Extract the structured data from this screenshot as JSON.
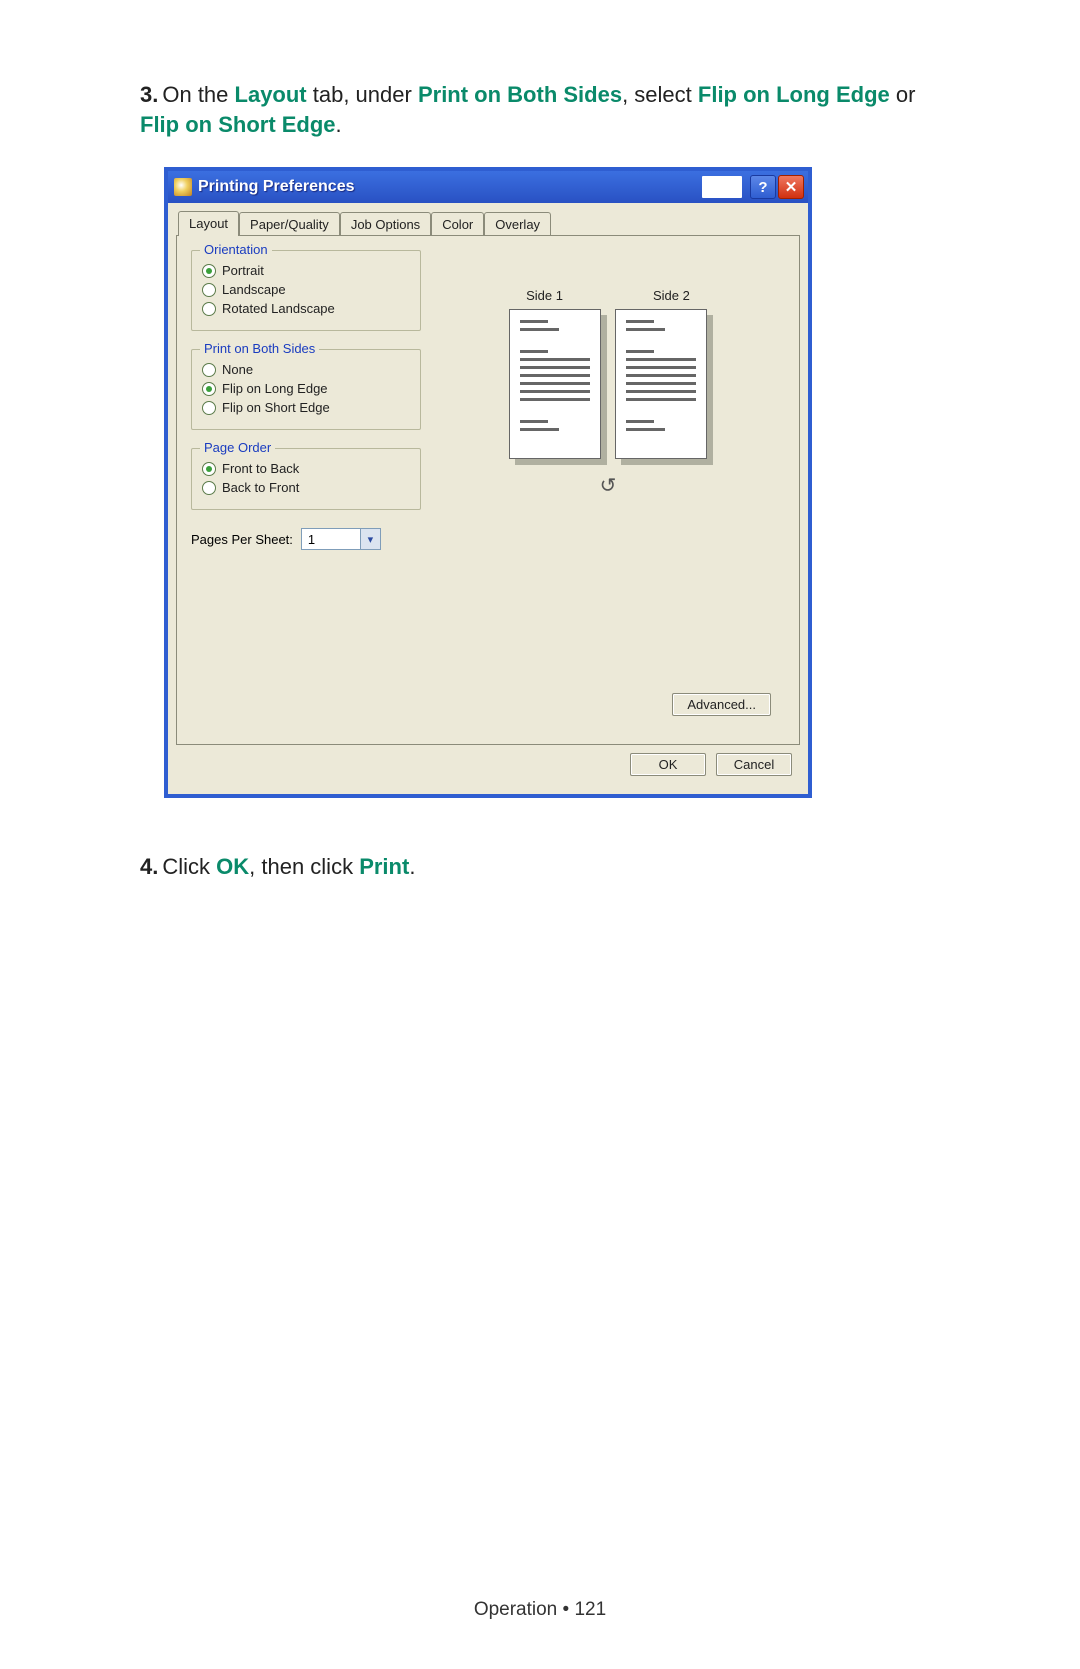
{
  "step3": {
    "num": "3.",
    "p1": "On the ",
    "hl1": "Layout",
    "p2": " tab, under ",
    "hl2": "Print on Both Sides",
    "p3": ", select ",
    "hl3": "Flip on Long Edge",
    "p4": " or ",
    "hl4": "Flip on Short Edge",
    "p5": "."
  },
  "step4": {
    "num": "4.",
    "p1": "Click ",
    "hl1": "OK",
    "p2": ", then click ",
    "hl2": "Print",
    "p3": "."
  },
  "dialog": {
    "title": "Printing Preferences",
    "tabs": [
      "Layout",
      "Paper/Quality",
      "Job Options",
      "Color",
      "Overlay"
    ],
    "activeTab": 0,
    "orientation": {
      "legend": "Orientation",
      "options": [
        "Portrait",
        "Landscape",
        "Rotated Landscape"
      ],
      "selected": 0
    },
    "bothsides": {
      "legend": "Print on Both Sides",
      "options": [
        "None",
        "Flip on Long Edge",
        "Flip on Short Edge"
      ],
      "selected": 1
    },
    "pageorder": {
      "legend": "Page Order",
      "options": [
        "Front to Back",
        "Back to Front"
      ],
      "selected": 0
    },
    "pagesPerSheet": {
      "label": "Pages Per Sheet:",
      "value": "1"
    },
    "sideLabels": [
      "Side 1",
      "Side 2"
    ],
    "advanced": "Advanced...",
    "ok": "OK",
    "cancel": "Cancel",
    "helpGlyph": "?",
    "closeGlyph": "✕"
  },
  "footer": {
    "section": "Operation",
    "sep": " • ",
    "page": "121"
  }
}
